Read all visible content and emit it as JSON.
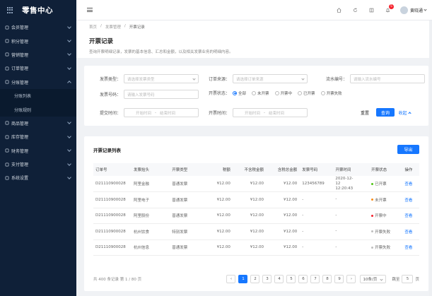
{
  "app": {
    "title": "零售中心"
  },
  "sidebar": {
    "items": [
      {
        "label": "会员管理",
        "icon": "user-icon",
        "open": false
      },
      {
        "label": "积分管理",
        "icon": "points-icon",
        "open": false
      },
      {
        "label": "营销管理",
        "icon": "marketing-icon",
        "open": false
      },
      {
        "label": "订单管理",
        "icon": "order-icon",
        "open": false
      },
      {
        "label": "分账管理",
        "icon": "split-icon",
        "open": true
      },
      {
        "label": "商品管理",
        "icon": "goods-icon",
        "open": false
      },
      {
        "label": "库存管理",
        "icon": "stock-icon",
        "open": false
      },
      {
        "label": "财务管理",
        "icon": "finance-icon",
        "open": false
      },
      {
        "label": "支付管理",
        "icon": "pay-icon",
        "open": false
      },
      {
        "label": "系统设置",
        "icon": "settings-icon",
        "open": false
      }
    ],
    "subitems": [
      "分账列表",
      "分账规则"
    ]
  },
  "header": {
    "username": "黄晓通",
    "notification_count": "5",
    "icons": [
      "home-icon",
      "refresh-icon",
      "fullscreen-icon",
      "bell-icon"
    ]
  },
  "breadcrumb": [
    "首页",
    "发票管理",
    "开票记录"
  ],
  "page": {
    "title": "开票记录",
    "description": "查询开票明细记录，发票的基本信息、汇总和金额，以及相关发票业务的明细内容。"
  },
  "filters": {
    "invoice_type_label": "发票类型：",
    "invoice_type_placeholder": "请选择发票类型",
    "order_source_label": "订单来源：",
    "order_source_placeholder": "请选择订单来源",
    "flow_no_label": "流水编号：",
    "flow_no_placeholder": "请输入流水编号",
    "invoice_no_label": "发票号码：",
    "invoice_no_placeholder": "请输入发票号码",
    "status_label": "开票状态：",
    "status_options": [
      "全部",
      "未开票",
      "开票中",
      "已开票",
      "开票失败"
    ],
    "status_selected": 0,
    "submit_time_label": "提交时间：",
    "invoice_time_label": "开票时间：",
    "start_placeholder": "开始时间",
    "end_placeholder": "结束时间",
    "range_sep": "-",
    "reset_label": "重置",
    "search_label": "查询",
    "collapse_label": "收起"
  },
  "table": {
    "title": "开票记录列表",
    "export_label": "导出",
    "columns": [
      "订单号",
      "发票抬头",
      "开票类型",
      "税额",
      "不含税金额",
      "含税总金额",
      "发票号码",
      "开票时间",
      "开票状态",
      "操作"
    ],
    "rows": [
      {
        "order": "D21110900028",
        "title": "阿里金融",
        "type": "普通发票",
        "tax": "¥12.00",
        "untaxed": "¥12.00",
        "total": "¥12.00",
        "invoice_no": "123456789",
        "time": "2020-12-12 12:20:43",
        "status": "已开票",
        "status_color": "#52c41a",
        "op": "查看"
      },
      {
        "order": "D21110900028",
        "title": "阿里电子",
        "type": "普通发票",
        "tax": "¥12.00",
        "untaxed": "¥12.00",
        "total": "¥12.00",
        "invoice_no": "-",
        "time": "-",
        "status": "未开票",
        "status_color": "#fa8c16",
        "op": "查看"
      },
      {
        "order": "D21110900028",
        "title": "阿里股份",
        "type": "普通发票",
        "tax": "¥12.00",
        "untaxed": "¥12.00",
        "total": "¥12.00",
        "invoice_no": "-",
        "time": "-",
        "status": "开票中",
        "status_color": "#f5222d",
        "op": "查看"
      },
      {
        "order": "D21110900028",
        "title": "杭州饮食",
        "type": "特别发票",
        "tax": "¥12.00",
        "untaxed": "¥12.00",
        "total": "¥12.00",
        "invoice_no": "-",
        "time": "-",
        "status": "开票失败",
        "status_color": "#bfbfbf",
        "op": "查看"
      },
      {
        "order": "D21110900028",
        "title": "杭州信息",
        "type": "普通发票",
        "tax": "¥12.00",
        "untaxed": "¥12.00",
        "total": "¥12.00",
        "invoice_no": "-",
        "time": "-",
        "status": "开票失败",
        "status_color": "#bfbfbf",
        "op": "查看"
      }
    ]
  },
  "pagination": {
    "total_text": "共 400 条记录 第 1 / 80 页",
    "pages": [
      "1",
      "2",
      "3",
      "4",
      "5",
      "6",
      "7",
      "8",
      "9"
    ],
    "current": "1",
    "prev": "‹",
    "next": "›",
    "page_size": "10条/页",
    "jump_prefix": "跳至",
    "jump_value": "5",
    "jump_suffix": "页"
  },
  "colors": {
    "accent": "#1677ff",
    "sidebar_bg": "#0f2038"
  }
}
